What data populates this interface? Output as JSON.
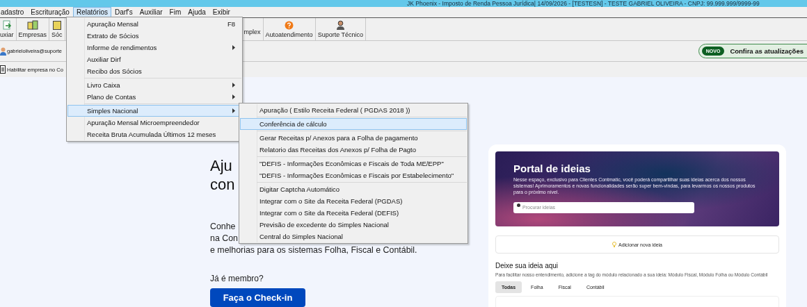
{
  "window": {
    "title": "JK Phoenix - Imposto de Renda Pessoa Jurídica| 14/09/2026 - [TESTESN] - TESTE GABRIEL OLIVEIRA - CNPJ: 99.999.999/9999-99"
  },
  "menubar": [
    {
      "label": "adastro",
      "selected": false
    },
    {
      "label": "Escrituração",
      "selected": false
    },
    {
      "label": "Relatórios",
      "selected": true
    },
    {
      "label": "Darf's",
      "selected": false
    },
    {
      "label": "Auxiliar",
      "selected": false
    },
    {
      "label": "Fim",
      "selected": false
    },
    {
      "label": "Ajuda",
      "selected": false
    },
    {
      "label": "Exibir",
      "selected": false
    }
  ],
  "toolbar": [
    {
      "label": "uxiar",
      "kind": "export"
    },
    {
      "label": "Empresas",
      "kind": "companies"
    },
    {
      "label": "Sóc",
      "kind": "partners"
    },
    {
      "label": "mplex",
      "kind": "hidden"
    },
    {
      "label": "Autoatendimento",
      "kind": "help"
    },
    {
      "label": "Suporte Técnico",
      "kind": "support"
    }
  ],
  "user": {
    "email": "gabrieloliveira@suporte"
  },
  "updates": {
    "badge": "NOVO",
    "label": "Confira as atualizações"
  },
  "enable_company": {
    "label": "Habilitar empresa no Co"
  },
  "menu": {
    "groups": [
      [
        {
          "label": "Apuração Mensal",
          "shortcut": "F8",
          "has_submenu": false,
          "selected": false
        },
        {
          "label": "Extrato de Sócios",
          "has_submenu": false,
          "selected": false
        },
        {
          "label": "Informe de rendimentos",
          "has_submenu": true,
          "selected": false
        },
        {
          "label": "Auxiliar Dirf",
          "has_submenu": false,
          "selected": false
        },
        {
          "label": "Recibo dos Sócios",
          "has_submenu": false,
          "selected": false
        }
      ],
      [
        {
          "label": "Livro Caixa",
          "has_submenu": true,
          "selected": false
        },
        {
          "label": "Plano de Contas",
          "has_submenu": true,
          "selected": false
        }
      ],
      [
        {
          "label": "Simples Nacional",
          "has_submenu": true,
          "selected": true
        },
        {
          "label": "Apuração Mensal Microempreendedor",
          "has_submenu": false,
          "selected": false
        },
        {
          "label": "Receita Bruta Acumulada Últimos 12 meses",
          "has_submenu": false,
          "selected": false
        }
      ]
    ]
  },
  "submenu": {
    "groups": [
      [
        {
          "label": "Apuração ( Estilo Receita Federal ( PGDAS 2018 ))",
          "selected": false
        }
      ],
      [
        {
          "label": "Conferência de cálculo",
          "selected": true
        }
      ],
      [
        {
          "label": "Gerar Receitas p/ Anexos para a Folha de pagamento",
          "selected": false
        },
        {
          "label": "Relatorio das Receitas dos Anexos p/ Folha de Pagto",
          "selected": false
        }
      ],
      [
        {
          "label": "\"DEFIS - Informações Econômicas e Fiscais de Toda ME/EPP\"",
          "selected": false
        },
        {
          "label": "\"DEFIS - Informações Econômicas e Fiscais por Estabelecimento\"",
          "selected": false
        }
      ],
      [
        {
          "label": "Digitar Captcha Automático",
          "selected": false
        },
        {
          "label": "Integrar com o Site da Receita Federal (PGDAS)",
          "selected": false
        },
        {
          "label": "Integrar com o Site da Receita Federal (DEFIS)",
          "selected": false
        },
        {
          "label": "Previsão de excedente do Simples Nacional",
          "selected": false
        },
        {
          "label": "Central do Simples Nacional",
          "selected": false
        }
      ]
    ]
  },
  "hero": {
    "heading_lines": [
      "Aju",
      "con"
    ],
    "paragraph_lines": [
      "Conhe",
      "na Con",
      "e melhorias para os sistemas Folha, Fiscal e Contábil."
    ],
    "member_prompt": "Já é membro?",
    "checkin_button": "Faça o Check-in"
  },
  "portal": {
    "title": "Portal de ideias",
    "description": "Nesse espaço, exclusivo para Clientes Contmatic, você poderá compartilhar suas ideias acerca dos nossos sistemas! Aprimoramentos e novas funcionalidades serão super bem-vindas, para levarmos os nossos produtos para o próximo nível.",
    "search": {
      "placeholder": "Procurar ideias"
    },
    "add_button": "Adicionar nova ideia",
    "section_title": "Deixe sua ideia aqui",
    "hint": "Para facilitar nosso entendimento, adicione a tag do módulo relacionado a sua ideia: Módulo Fiscal, Módulo Folha ou Módulo Contábil",
    "tabs": [
      {
        "label": "Todas",
        "selected": true
      },
      {
        "label": "Folha",
        "selected": false
      },
      {
        "label": "Fiscal",
        "selected": false
      },
      {
        "label": "Contábil",
        "selected": false
      }
    ]
  }
}
